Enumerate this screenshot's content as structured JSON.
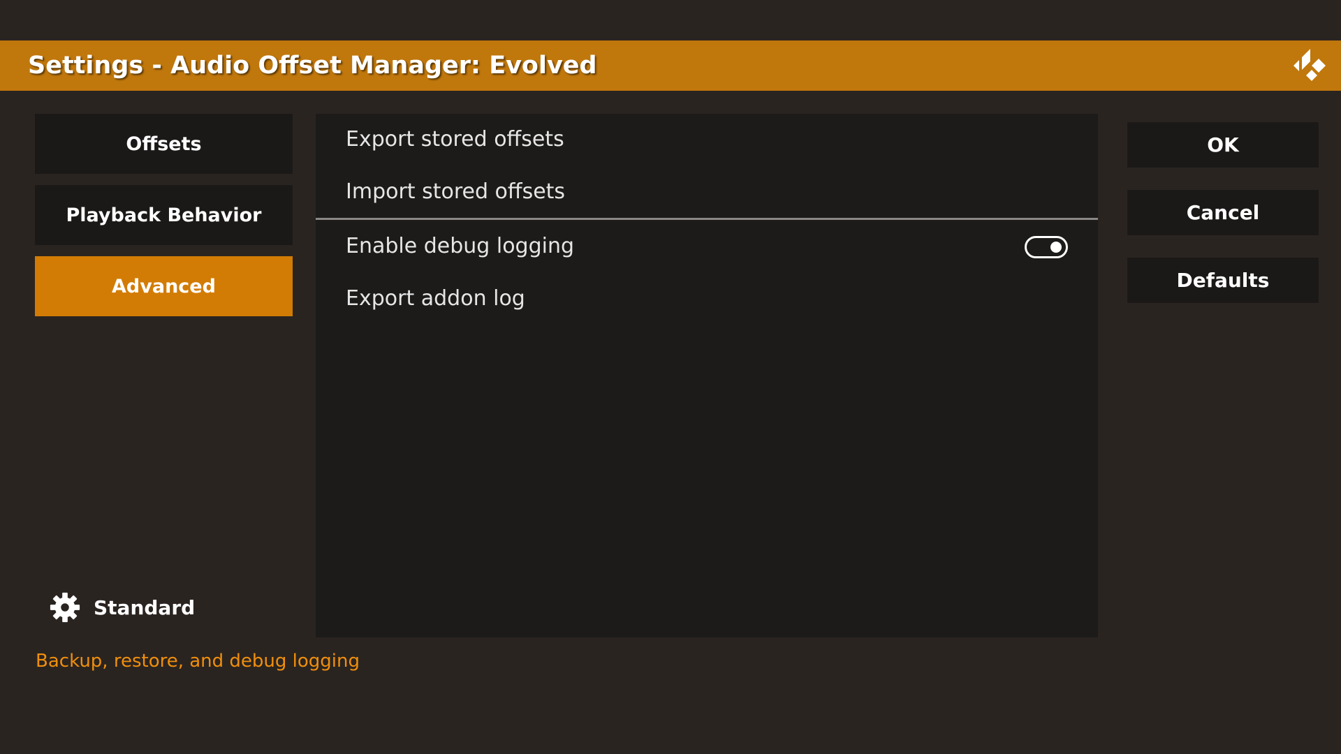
{
  "header": {
    "title": "Settings - Audio Offset Manager: Evolved",
    "logo_icon": "kodi-logo-icon"
  },
  "categories": [
    {
      "label": "Offsets",
      "selected": false
    },
    {
      "label": "Playback Behavior",
      "selected": false
    },
    {
      "label": "Advanced",
      "selected": true
    }
  ],
  "settings": {
    "items": [
      {
        "label": "Export stored offsets"
      },
      {
        "label": "Import stored offsets"
      },
      {
        "label": "Enable debug logging",
        "toggle_on": true
      },
      {
        "label": "Export addon log"
      }
    ]
  },
  "actions": {
    "ok": "OK",
    "cancel": "Cancel",
    "defaults": "Defaults"
  },
  "level": {
    "icon": "gear-icon",
    "label": "Standard"
  },
  "description": "Backup, restore, and debug logging",
  "colors": {
    "accent": "#c0770c",
    "selected": "#d27c05",
    "description_text": "#f08f0c",
    "background": "#2a2421",
    "panel": "#1c1b19"
  }
}
